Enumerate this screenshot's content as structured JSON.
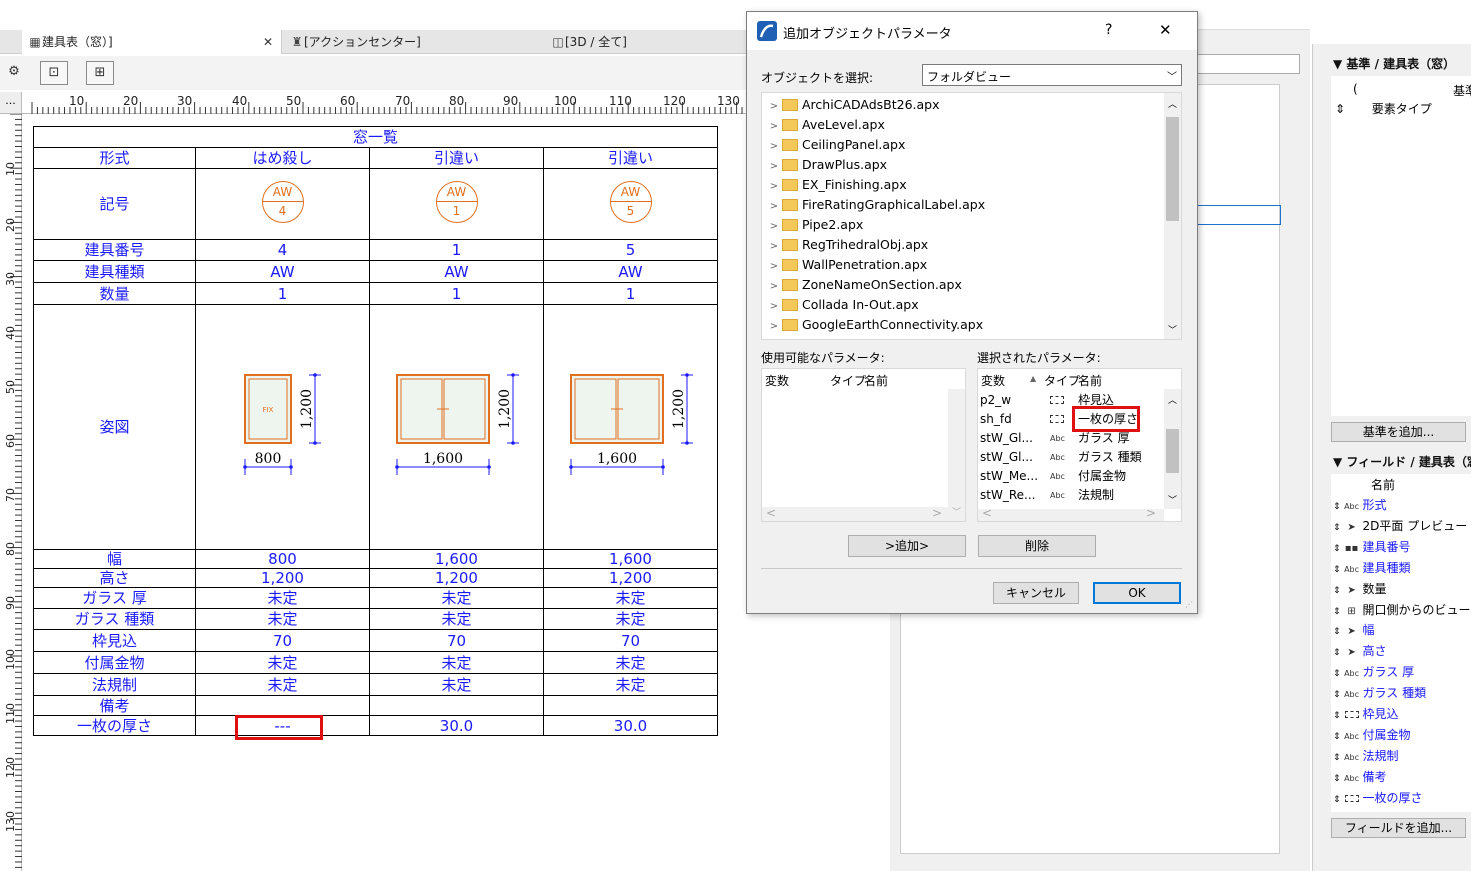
{
  "tabs": [
    {
      "label": "建具表（窓）]",
      "icon": "table-icon"
    },
    {
      "label": "[アクションセンター]",
      "icon": "action-center-icon"
    },
    {
      "label": "[3D / 全て]",
      "icon": "3d-view-icon"
    }
  ],
  "ruler": {
    "top": [
      "10",
      "20",
      "30",
      "40",
      "50",
      "60",
      "70",
      "80",
      "90",
      "100",
      "110",
      "120",
      "130"
    ],
    "left": [
      "10",
      "20",
      "30",
      "40",
      "50",
      "60",
      "70",
      "80",
      "90",
      "100",
      "110",
      "120",
      "130"
    ]
  },
  "schedule": {
    "title": "窓一覧",
    "labels": {
      "type": "形式",
      "mark": "記号",
      "number": "建具番号",
      "kind": "建具種類",
      "qty": "数量",
      "figure": "姿図",
      "width": "幅",
      "height": "高さ",
      "glass_thickness": "ガラス 厚",
      "glass_type": "ガラス 種類",
      "frame_depth": "枠見込",
      "hardware": "付属金物",
      "regulation": "法規制",
      "remarks": "備考",
      "panel_thickness": "一枚の厚さ"
    },
    "columns": [
      {
        "type": "はめ殺し",
        "mark_top": "AW",
        "mark_num": "4",
        "number": "4",
        "kind": "AW",
        "qty": "1",
        "fig_w": "800",
        "fig_h": "1,200",
        "fig_label": "FIX",
        "width": "800",
        "height": "1,200",
        "glass_thickness": "未定",
        "glass_type": "未定",
        "frame_depth": "70",
        "hardware": "未定",
        "regulation": "未定",
        "remarks": "",
        "panel_thickness": "---"
      },
      {
        "type": "引違い",
        "mark_top": "AW",
        "mark_num": "1",
        "number": "1",
        "kind": "AW",
        "qty": "1",
        "fig_w": "1,600",
        "fig_h": "1,200",
        "fig_label": "",
        "width": "1,600",
        "height": "1,200",
        "glass_thickness": "未定",
        "glass_type": "未定",
        "frame_depth": "70",
        "hardware": "未定",
        "regulation": "未定",
        "remarks": "",
        "panel_thickness": "30.0"
      },
      {
        "type": "引違い",
        "mark_top": "AW",
        "mark_num": "5",
        "number": "5",
        "kind": "AW",
        "qty": "1",
        "fig_w": "1,600",
        "fig_h": "1,200",
        "fig_label": "",
        "width": "1,600",
        "height": "1,200",
        "glass_thickness": "未定",
        "glass_type": "未定",
        "frame_depth": "70",
        "hardware": "未定",
        "regulation": "未定",
        "remarks": "",
        "panel_thickness": "30.0"
      }
    ]
  },
  "dialog": {
    "title": "追加オブジェクトパラメータ",
    "help": "?",
    "close": "✕",
    "select_label": "オブジェクトを選択:",
    "select_value": "フォルダビュー",
    "files": [
      "ArchiCADAdsBt26.apx",
      "AveLevel.apx",
      "CeilingPanel.apx",
      "DrawPlus.apx",
      "EX_Finishing.apx",
      "FireRatingGraphicalLabel.apx",
      "Pipe2.apx",
      "RegTrihedralObj.apx",
      "WallPenetration.apx",
      "ZoneNameOnSection.apx",
      "Collada In-Out.apx",
      "GoogleEarthConnectivity.apx"
    ],
    "available_label": "使用可能なパラメータ:",
    "selected_label": "選択されたパラメータ:",
    "col_var": "変数",
    "col_type": "タイプ",
    "col_name": "名前",
    "selected_params": [
      {
        "var": "p2_w",
        "type": "dim-icon",
        "name": "枠見込"
      },
      {
        "var": "sh_fd",
        "type": "dim-icon",
        "name": "一枚の厚さ"
      },
      {
        "var": "stW_Gl...",
        "type": "Abc",
        "name": "ガラス 厚"
      },
      {
        "var": "stW_Gl...",
        "type": "Abc",
        "name": "ガラス 種類"
      },
      {
        "var": "stW_Me...",
        "type": "Abc",
        "name": "付属金物"
      },
      {
        "var": "stW_Re...",
        "type": "Abc",
        "name": "法規制"
      }
    ],
    "add_button": ">追加>",
    "delete_button": "削除",
    "cancel_button": "キャンセル",
    "ok_button": "OK"
  },
  "right_panel": {
    "criteria_header": "基準 /  建具表（窓）",
    "criteria_col": "基準",
    "criteria_paren": "(",
    "criteria_item": "要素タイプ",
    "add_criteria": "基準を追加...",
    "fields_header": "フィールド /  建具表（窓",
    "name_col": "名前",
    "fields": [
      {
        "icon": "Abc",
        "name": "形式"
      },
      {
        "icon": "cursor",
        "name": "2D平面 プレビュー"
      },
      {
        "icon": "num",
        "name": "建具番号"
      },
      {
        "icon": "Abc",
        "name": "建具種類"
      },
      {
        "icon": "cursor",
        "name": "数量"
      },
      {
        "icon": "grid",
        "name": "開口側からのビュー"
      },
      {
        "icon": "cursor",
        "name": "幅"
      },
      {
        "icon": "cursor",
        "name": "高さ"
      },
      {
        "icon": "Abc",
        "name": "ガラス 厚"
      },
      {
        "icon": "Abc",
        "name": "ガラス 種類"
      },
      {
        "icon": "dim",
        "name": "枠見込"
      },
      {
        "icon": "Abc",
        "name": "付属金物"
      },
      {
        "icon": "Abc",
        "name": "法規制"
      },
      {
        "icon": "Abc",
        "name": "備考"
      },
      {
        "icon": "dim",
        "name": "一枚の厚さ"
      }
    ],
    "add_field": "フィールドを追加..."
  },
  "colors": {
    "schedule_text": "#1a1aff",
    "mark": "#e07020",
    "highlight": "#e01010"
  }
}
